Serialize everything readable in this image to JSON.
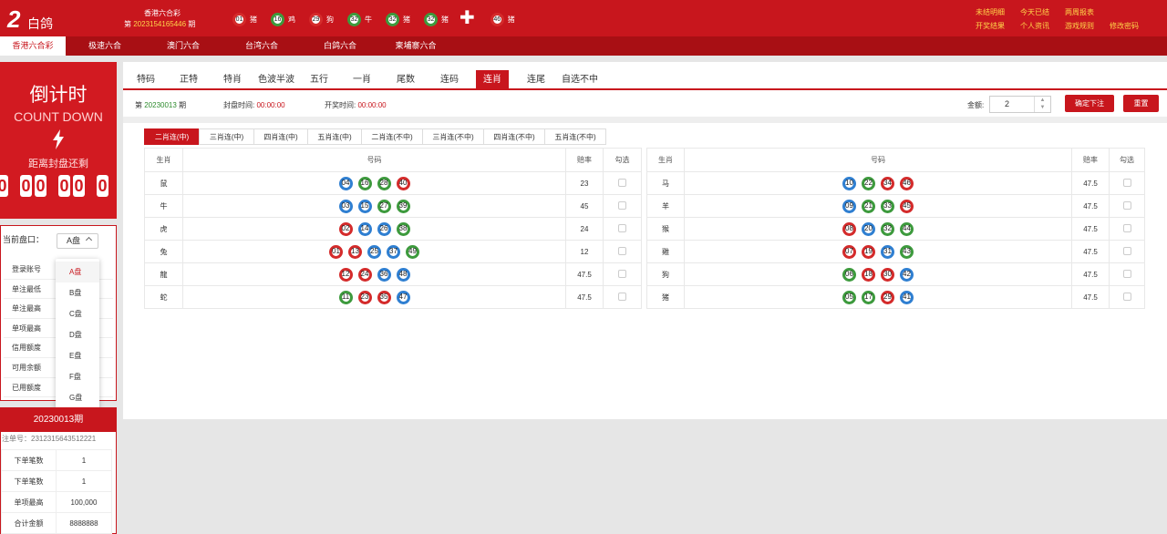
{
  "header": {
    "logo_num": "2",
    "logo_text": "白鸽",
    "lottery_name": "香港六合彩",
    "period_prefix": "第",
    "period_num": "2023154165446",
    "period_suffix": "期",
    "balls": [
      {
        "num": "01",
        "zodiac": "猪",
        "color": "red"
      },
      {
        "num": "16",
        "zodiac": "鸡",
        "color": "green"
      },
      {
        "num": "29",
        "zodiac": "狗",
        "color": "red"
      },
      {
        "num": "32",
        "zodiac": "牛",
        "color": "green"
      },
      {
        "num": "32",
        "zodiac": "猪",
        "color": "green"
      },
      {
        "num": "32",
        "zodiac": "猪",
        "color": "green"
      }
    ],
    "special_ball": {
      "num": "46",
      "zodiac": "猪",
      "color": "red"
    },
    "links": [
      "未结明细",
      "今天已结",
      "两周报表",
      "",
      "开奖结果",
      "个人资讯",
      "游戏规则",
      "修改密码"
    ]
  },
  "nav": [
    "香港六合彩",
    "极速六合",
    "澳门六合",
    "台湾六合",
    "白鸽六合",
    "柬埔寨六合"
  ],
  "countdown": {
    "title": "倒计时",
    "subtitle": "COUNT DOWN",
    "label": "距离封盘还剩",
    "digits": [
      "0",
      "0",
      "0",
      "0",
      "0",
      "0"
    ]
  },
  "panel": {
    "label": "当前盘口：",
    "selected": "A盘",
    "info_labels": [
      "登录账号",
      "单注最低",
      "单注最高",
      "单项最高",
      "信用额度",
      "可用余额",
      "已用额度"
    ],
    "options": [
      "A盘",
      "B盘",
      "C盘",
      "D盘",
      "E盘",
      "F盘",
      "G盘"
    ]
  },
  "order": {
    "title": "20230013期",
    "order_no": "注单号：2312315643512221",
    "rows": [
      {
        "label": "下单笔数",
        "value": "1"
      },
      {
        "label": "下单笔数",
        "value": "1"
      },
      {
        "label": "单项最高",
        "value": "100,000"
      },
      {
        "label": "合计金额",
        "value": "8888888"
      }
    ]
  },
  "tabs": [
    "特码",
    "正特",
    "特肖",
    "色波半波",
    "五行",
    "一肖",
    "尾数",
    "连码",
    "连肖",
    "连尾",
    "自选不中"
  ],
  "active_tab": "连肖",
  "bar": {
    "period_prefix": "第",
    "period": "20230013",
    "period_suffix": "期",
    "close_label": "封盘时间:",
    "close_time": "00:00:00",
    "open_label": "开奖时间:",
    "open_time": "00:00:00",
    "amount_label": "金额:",
    "amount": "2",
    "confirm": "确定下注",
    "reset": "重置"
  },
  "subtabs": [
    "二肖连(中)",
    "三肖连(中)",
    "四肖连(中)",
    "五肖连(中)",
    "二肖连(不中)",
    "三肖连(不中)",
    "四肖连(不中)",
    "五肖连(不中)"
  ],
  "table_headers": [
    "生肖",
    "号码",
    "赔率",
    "勾选"
  ],
  "left_rows": [
    {
      "zodiac": "鼠",
      "odds": "23",
      "balls": [
        [
          "04",
          "b"
        ],
        [
          "16",
          "g"
        ],
        [
          "28",
          "g"
        ],
        [
          "40",
          "r"
        ]
      ]
    },
    {
      "zodiac": "牛",
      "odds": "45",
      "balls": [
        [
          "03",
          "b"
        ],
        [
          "15",
          "b"
        ],
        [
          "27",
          "g"
        ],
        [
          "39",
          "g"
        ]
      ]
    },
    {
      "zodiac": "虎",
      "odds": "24",
      "balls": [
        [
          "02",
          "r"
        ],
        [
          "14",
          "b"
        ],
        [
          "26",
          "b"
        ],
        [
          "38",
          "g"
        ]
      ]
    },
    {
      "zodiac": "兔",
      "odds": "12",
      "balls": [
        [
          "01",
          "r"
        ],
        [
          "13",
          "r"
        ],
        [
          "25",
          "b"
        ],
        [
          "37",
          "b"
        ],
        [
          "49",
          "g"
        ]
      ]
    },
    {
      "zodiac": "龍",
      "odds": "47.5",
      "balls": [
        [
          "12",
          "r"
        ],
        [
          "24",
          "r"
        ],
        [
          "36",
          "b"
        ],
        [
          "48",
          "b"
        ]
      ]
    },
    {
      "zodiac": "蛇",
      "odds": "47.5",
      "balls": [
        [
          "11",
          "g"
        ],
        [
          "23",
          "r"
        ],
        [
          "35",
          "r"
        ],
        [
          "47",
          "b"
        ]
      ]
    }
  ],
  "right_rows": [
    {
      "zodiac": "马",
      "odds": "47.5",
      "balls": [
        [
          "10",
          "b"
        ],
        [
          "22",
          "g"
        ],
        [
          "34",
          "r"
        ],
        [
          "46",
          "r"
        ]
      ]
    },
    {
      "zodiac": "羊",
      "odds": "47.5",
      "balls": [
        [
          "09",
          "b"
        ],
        [
          "21",
          "g"
        ],
        [
          "33",
          "g"
        ],
        [
          "45",
          "r"
        ]
      ]
    },
    {
      "zodiac": "猴",
      "odds": "47.5",
      "balls": [
        [
          "08",
          "r"
        ],
        [
          "20",
          "b"
        ],
        [
          "32",
          "g"
        ],
        [
          "44",
          "g"
        ]
      ]
    },
    {
      "zodiac": "雞",
      "odds": "47.5",
      "balls": [
        [
          "07",
          "r"
        ],
        [
          "19",
          "r"
        ],
        [
          "31",
          "b"
        ],
        [
          "43",
          "g"
        ]
      ]
    },
    {
      "zodiac": "狗",
      "odds": "47.5",
      "balls": [
        [
          "06",
          "g"
        ],
        [
          "18",
          "r"
        ],
        [
          "30",
          "r"
        ],
        [
          "42",
          "b"
        ]
      ]
    },
    {
      "zodiac": "猪",
      "odds": "47.5",
      "balls": [
        [
          "05",
          "g"
        ],
        [
          "17",
          "g"
        ],
        [
          "29",
          "r"
        ],
        [
          "41",
          "b"
        ]
      ]
    }
  ]
}
